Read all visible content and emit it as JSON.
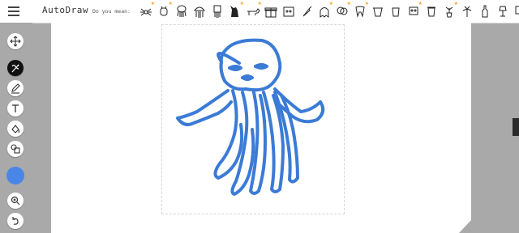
{
  "header": {
    "title": "AutoDraw",
    "suggestions_label": "Do you mean:",
    "suggestions": [
      "spider-icon",
      "bug-icon",
      "octopus-icon",
      "jellyfish-icon",
      "squid-icon",
      "cat-icon",
      "dog-icon",
      "gift-icon",
      "cat-face-icon",
      "carrot-icon",
      "ghost-icon",
      "brain-icon",
      "tooth-icon",
      "bucket-icon",
      "cup-icon",
      "robot-icon",
      "trash-can-icon",
      "potted-plant-icon",
      "palm-tree-icon",
      "bottle-icon",
      "lamp-icon",
      "easel-icon"
    ]
  },
  "toolbar": {
    "tools": [
      "move-tool",
      "autodraw-tool",
      "draw-tool",
      "type-tool",
      "fill-tool",
      "shape-tool",
      "color-picker",
      "zoom-tool",
      "undo-tool"
    ]
  },
  "colors": {
    "accent": "#4a86e8",
    "stroke": "#3b7bd6",
    "background": "#a9a9a9",
    "star": "#f4a62a"
  }
}
